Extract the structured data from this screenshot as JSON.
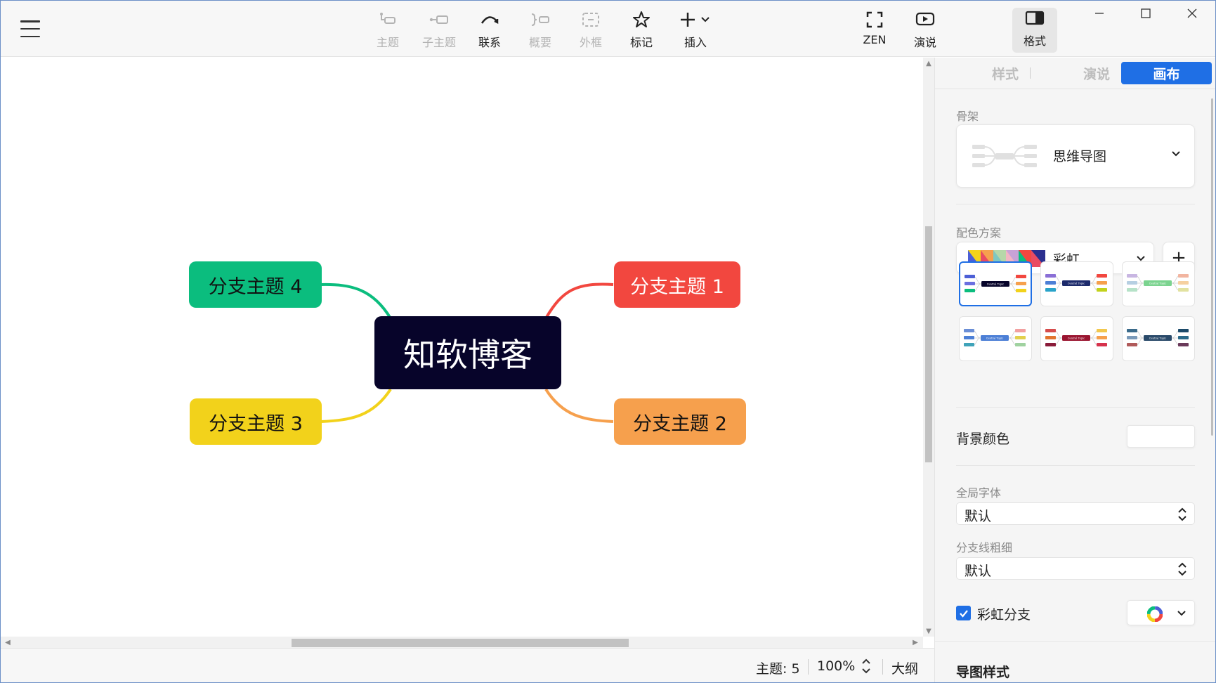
{
  "toolbar": {
    "menu_icon": "hamburger-menu-icon",
    "tools": [
      {
        "key": "topic",
        "label": "主题",
        "icon": "topic-icon",
        "enabled": false
      },
      {
        "key": "subtopic",
        "label": "子主题",
        "icon": "subtopic-icon",
        "enabled": false
      },
      {
        "key": "relationship",
        "label": "联系",
        "icon": "relationship-curve-icon",
        "enabled": true
      },
      {
        "key": "summary",
        "label": "概要",
        "icon": "summary-bracket-icon",
        "enabled": false
      },
      {
        "key": "boundary",
        "label": "外框",
        "icon": "boundary-box-icon",
        "enabled": false
      },
      {
        "key": "marker",
        "label": "标记",
        "icon": "star-icon",
        "enabled": true
      },
      {
        "key": "insert",
        "label": "插入",
        "icon": "plus-dropdown-icon",
        "enabled": true
      },
      {
        "key": "zen",
        "label": "ZEN",
        "icon": "fullscreen-icon",
        "enabled": true
      },
      {
        "key": "pitch",
        "label": "演说",
        "icon": "play-screen-icon",
        "enabled": true
      },
      {
        "key": "format",
        "label": "格式",
        "icon": "panel-toggle-icon",
        "enabled": true,
        "active": true
      }
    ],
    "window_controls": [
      "minimize-icon",
      "maximize-icon",
      "close-icon"
    ]
  },
  "mindmap": {
    "central": {
      "label": "知软博客",
      "color": "#07042a"
    },
    "branches": [
      {
        "label": "分支主题 1",
        "color": "#f2473f"
      },
      {
        "label": "分支主题 2",
        "color": "#f6a04d"
      },
      {
        "label": "分支主题 3",
        "color": "#f2d21b"
      },
      {
        "label": "分支主题 4",
        "color": "#0bbd7e"
      }
    ]
  },
  "statusbar": {
    "topics": "主题: 5",
    "zoom": "100%",
    "outline": "大纲"
  },
  "panel": {
    "tabs": [
      {
        "label": "样式",
        "active": false
      },
      {
        "label": "演说",
        "active": false
      },
      {
        "label": "画布",
        "active": true
      }
    ],
    "structure": {
      "label": "骨架",
      "value": "思维导图"
    },
    "color_scheme": {
      "label": "配色方案",
      "value": "彩虹",
      "add": "+",
      "themes_selected_index": 0,
      "theme_thumbnail_text": "Central Topic"
    },
    "background": {
      "label": "背景颜色",
      "value": "#ffffff"
    },
    "global_font": {
      "label": "全局字体",
      "value": "默认"
    },
    "branch_width": {
      "label": "分支线粗细",
      "value": "默认"
    },
    "rainbow_branch": {
      "label": "彩虹分支",
      "checked": true
    },
    "map_style": {
      "label": "导图样式"
    }
  },
  "accent": "#1f6fe5"
}
